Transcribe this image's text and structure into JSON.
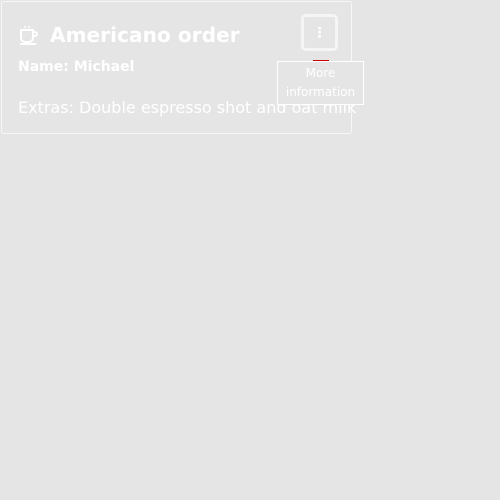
{
  "card": {
    "title": "Americano order",
    "name_line": "Name: Michael",
    "extras_line": "Extras: Double espresso shot and oat milk",
    "title_icon": "coffee-cup-icon"
  },
  "more_button": {
    "icon": "more-vertical-icon",
    "glyph": "⋮"
  },
  "tooltip": {
    "text": "More information"
  },
  "colors": {
    "background": "#e5e5e5",
    "text": "#ffffff",
    "accent": "#c80000"
  }
}
